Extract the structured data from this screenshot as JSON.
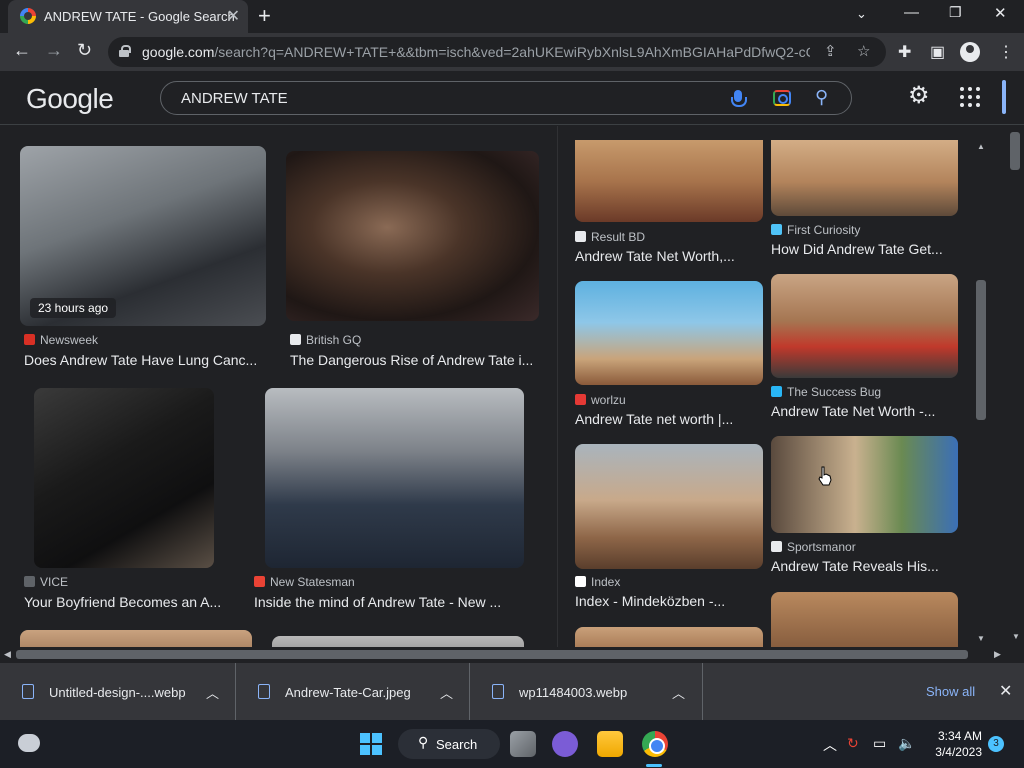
{
  "browser": {
    "tab_title": "ANDREW TATE - Google Search",
    "url_domain": "google.com",
    "url_rest": "/search?q=ANDREW+TATE+&&tbm=isch&ved=2ahUKEwiRybXnlsL9AhXmBGIAHaPdDfwQ2-cC..."
  },
  "google": {
    "logo_text": "Google",
    "search_query": "ANDREW TATE"
  },
  "results": [
    {
      "source": "Newsweek",
      "title": "Does Andrew Tate Have Lung Canc...",
      "badge": "23 hours ago",
      "src_color": "#d93025"
    },
    {
      "source": "British GQ",
      "title": "The Dangerous Rise of Andrew Tate i...",
      "src_color": "#e8eaed"
    },
    {
      "source": "VICE",
      "title": "Your Boyfriend Becomes an A...",
      "src_color": "#5f6368"
    },
    {
      "source": "New Statesman",
      "title": "Inside the mind of Andrew Tate - New ...",
      "src_color": "#ea4335"
    },
    {
      "source": "Result BD",
      "title": "Andrew Tate Net Worth,...",
      "src_color": "#e8eaed"
    },
    {
      "source": "First Curiosity",
      "title": "How Did Andrew Tate Get...",
      "src_color": "#4fc3f7"
    },
    {
      "source": "worlzu",
      "title": "Andrew Tate net worth |...",
      "src_color": "#e53935"
    },
    {
      "source": "The Success Bug",
      "title": "Andrew Tate Net Worth -...",
      "src_color": "#29b6f6"
    },
    {
      "source": "Sportsmanor",
      "title": "Andrew Tate Reveals His...",
      "src_color": "#e8eaed"
    },
    {
      "source": "Index",
      "title": "Index - Mindeközben -...",
      "src_color": "#ffffff"
    }
  ],
  "downloads": [
    {
      "name": "Untitled-design-....webp"
    },
    {
      "name": "Andrew-Tate-Car.jpeg"
    },
    {
      "name": "wp11484003.webp"
    }
  ],
  "downloads_show_all": "Show all",
  "taskbar": {
    "search_label": "Search",
    "time": "3:34 AM",
    "date": "3/4/2023",
    "notifications": "3"
  },
  "icons": [
    "chrome-favicon",
    "close-icon",
    "plus-icon",
    "minimize-icon",
    "restore-icon",
    "back-icon",
    "forward-icon",
    "reload-icon",
    "lock-icon",
    "share-icon",
    "star-icon",
    "extensions-icon",
    "sidepanel-icon",
    "profile-icon",
    "kebab-menu-icon",
    "mic-icon",
    "lens-icon",
    "search-icon",
    "gear-icon",
    "apps-grid-icon",
    "file-icon",
    "chevron-up-icon"
  ]
}
